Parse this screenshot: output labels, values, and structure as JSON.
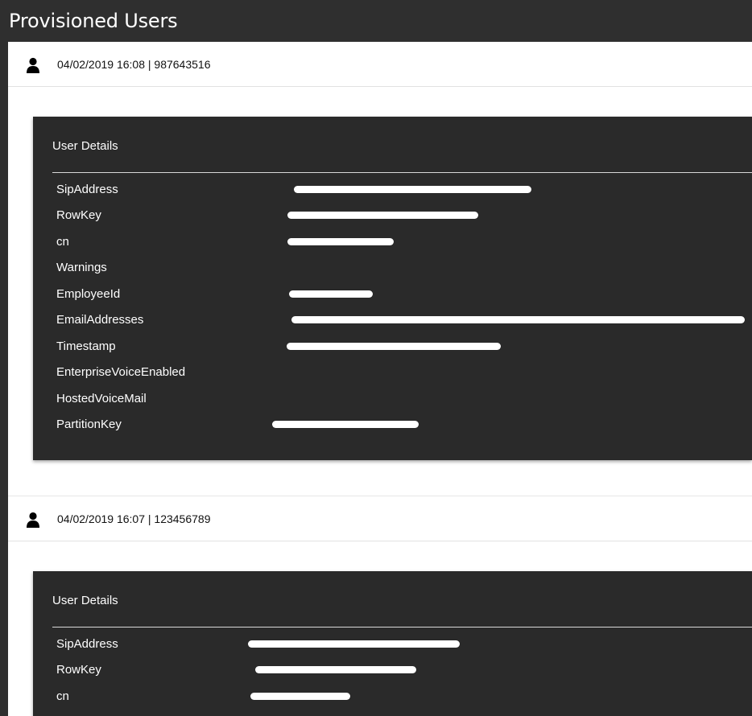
{
  "page": {
    "title": "Provisioned Users"
  },
  "entries": [
    {
      "meta": "04/02/2019 16:08 | 987643516",
      "details_title": "User Details",
      "properties": [
        {
          "key": "SipAddress",
          "redacted": true
        },
        {
          "key": "RowKey",
          "redacted": true
        },
        {
          "key": "cn",
          "redacted": true
        },
        {
          "key": "Warnings",
          "redacted": false
        },
        {
          "key": "EmployeeId",
          "redacted": true
        },
        {
          "key": "EmailAddresses",
          "redacted": true
        },
        {
          "key": "Timestamp",
          "redacted": true
        },
        {
          "key": "EnterpriseVoiceEnabled",
          "redacted": false
        },
        {
          "key": "HostedVoiceMail",
          "redacted": false
        },
        {
          "key": "PartitionKey",
          "redacted": true
        }
      ]
    },
    {
      "meta": "04/02/2019 16:07 | 123456789",
      "details_title": "User Details",
      "properties": [
        {
          "key": "SipAddress",
          "redacted": true
        },
        {
          "key": "RowKey",
          "redacted": true
        },
        {
          "key": "cn",
          "redacted": true
        }
      ]
    }
  ],
  "icons": {
    "entry_icon": "user-icon"
  }
}
